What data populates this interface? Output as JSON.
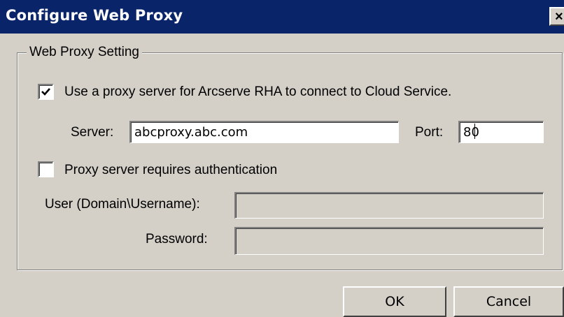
{
  "window": {
    "title": "Configure Web Proxy",
    "close_symbol": "×"
  },
  "group": {
    "legend": "Web Proxy Setting"
  },
  "use_proxy": {
    "checked": true,
    "label": "Use a proxy server for Arcserve RHA to connect to Cloud Service."
  },
  "server": {
    "label": "Server:",
    "value": "abcproxy.abc.com"
  },
  "port": {
    "label": "Port:",
    "value": "80"
  },
  "auth": {
    "checked": false,
    "label": "Proxy server requires authentication"
  },
  "user": {
    "label": "User (Domain\\Username):",
    "value": ""
  },
  "password": {
    "label": "Password:",
    "value": ""
  },
  "buttons": {
    "ok": "OK",
    "cancel": "Cancel"
  },
  "colors": {
    "titlebar": "#0a246a",
    "dialog_bg": "#d4d0c8"
  }
}
